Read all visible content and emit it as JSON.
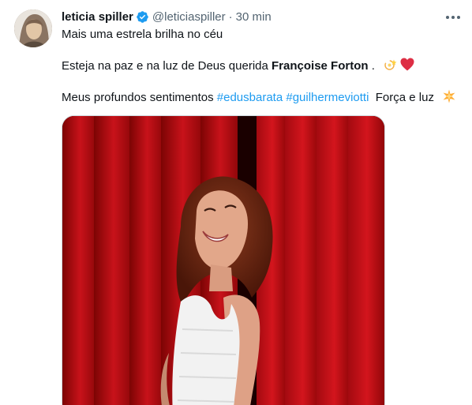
{
  "tweet": {
    "display_name": "leticia spiller",
    "handle": "@leticiaspiller",
    "separator": "·",
    "time": "30 min",
    "line1": "Mais uma estrela brilha no céu",
    "line2_prefix": "Esteja na paz e na luz de Deus querida ",
    "line2_bold": "Françoise Forton",
    "line2_suffix": " .",
    "line3_prefix": "Meus profundos sentimentos ",
    "hashtag1": "#edusbarata",
    "hashtag2": "#guilhermeviotti",
    "line3_suffix": "  Força e luz",
    "emojis": [
      "dizzy-emoji",
      "red-heart-emoji",
      "glowing-star-emoji"
    ]
  },
  "colors": {
    "link": "#1d9bf0",
    "secondary_text": "#536471",
    "verified_badge": "#1d9bf0",
    "curtain_red": "#b30d0d"
  }
}
